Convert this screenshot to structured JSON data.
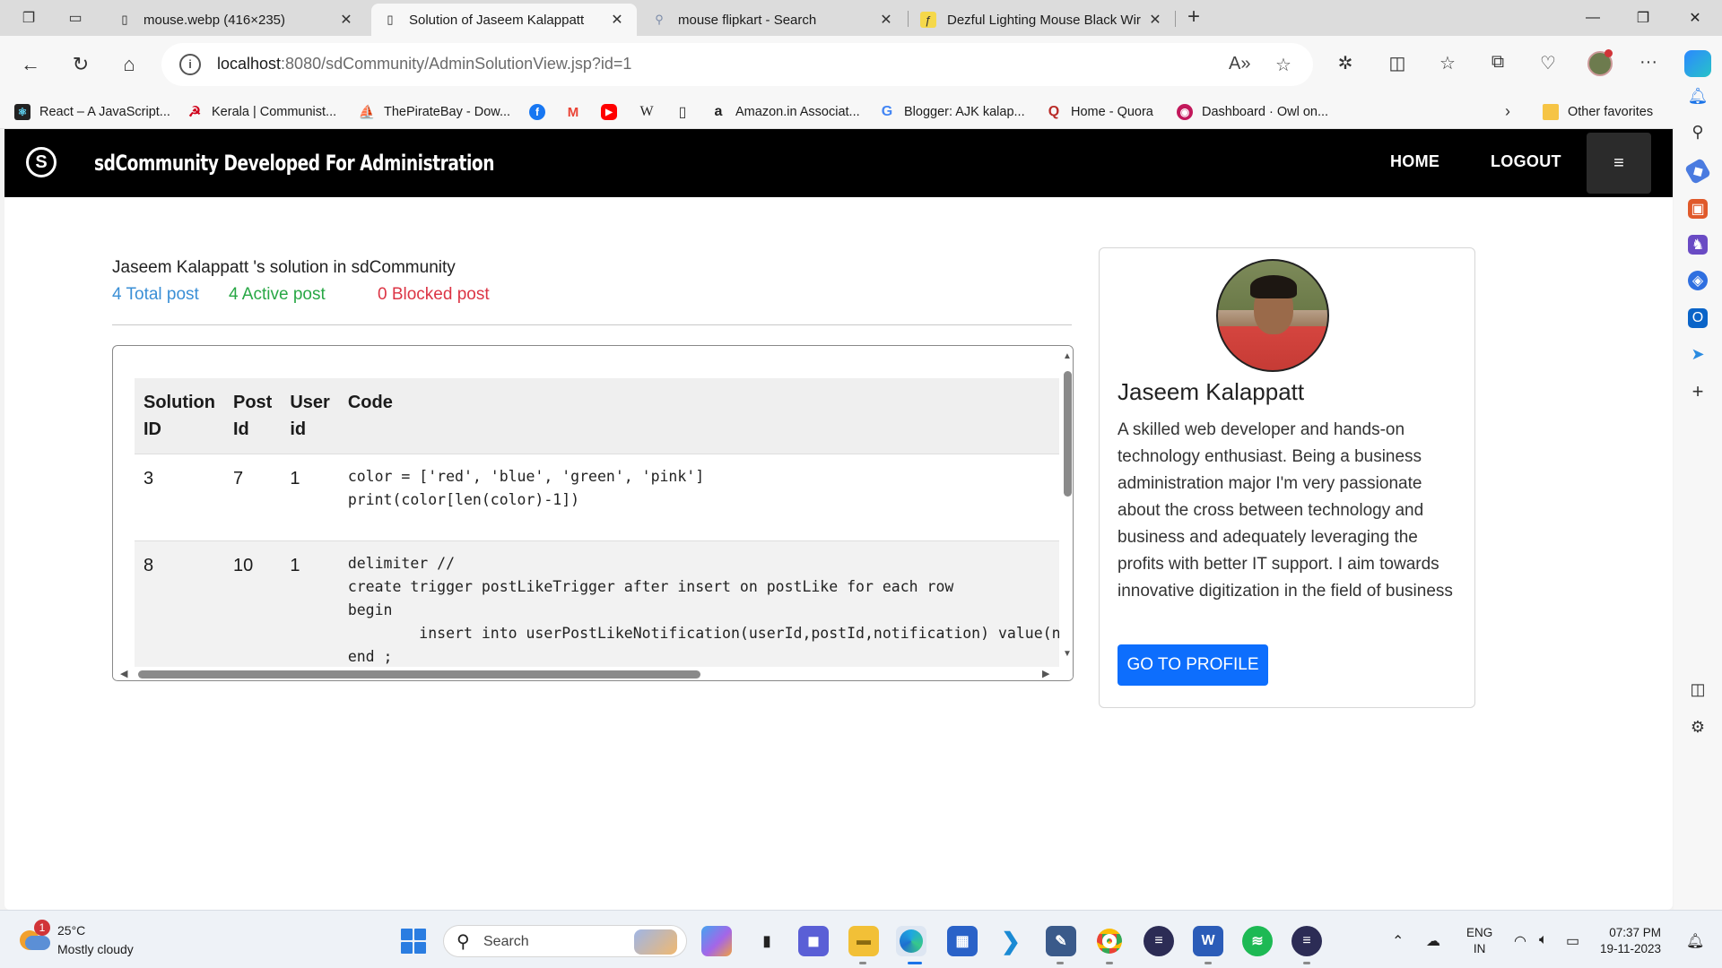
{
  "browser": {
    "tabs": [
      {
        "title": "mouse.webp (416×235)",
        "active": false
      },
      {
        "title": "Solution of Jaseem Kalappatt",
        "active": true
      },
      {
        "title": "mouse flipkart - Search",
        "active": false
      },
      {
        "title": "Dezful Lighting Mouse Black Wir",
        "active": false
      }
    ],
    "url_host": "localhost",
    "url_rest": ":8080/sdCommunity/AdminSolutionView.jsp?id=1",
    "favorites": [
      {
        "label": "React – A JavaScript...",
        "icon": "react-icon",
        "color": "#222222",
        "glyph": "⚛"
      },
      {
        "label": "Kerala | Communist...",
        "icon": "hammer-sickle-icon",
        "color": "#d0021b",
        "glyph": "☭"
      },
      {
        "label": "ThePirateBay - Dow...",
        "icon": "pirate-ship-icon",
        "color": "#333333",
        "glyph": "⛵"
      },
      {
        "label": "",
        "icon": "facebook-icon",
        "color": "#1877f2",
        "glyph": "f"
      },
      {
        "label": "",
        "icon": "gmail-icon",
        "color": "#ea4335",
        "glyph": "M"
      },
      {
        "label": "",
        "icon": "youtube-icon",
        "color": "#ff0000",
        "glyph": "▶"
      },
      {
        "label": "",
        "icon": "wikipedia-icon",
        "color": "#ffffff",
        "glyph": "W"
      },
      {
        "label": "",
        "icon": "page-icon",
        "color": "#ffffff",
        "glyph": "▯"
      },
      {
        "label": "Amazon.in Associat...",
        "icon": "amazon-icon",
        "color": "#ffffff",
        "glyph": "a"
      },
      {
        "label": "Blogger: AJK kalap...",
        "icon": "google-icon",
        "color": "#ffffff",
        "glyph": "G"
      },
      {
        "label": "Home - Quora",
        "icon": "quora-icon",
        "color": "#b92b27",
        "glyph": "Q"
      },
      {
        "label": "Dashboard · Owl on...",
        "icon": "owl-icon",
        "color": "#c2185b",
        "glyph": "◉"
      }
    ],
    "other_favorites": "Other favorites"
  },
  "site": {
    "title": "sdCommunity Developed For Administration",
    "nav": {
      "home": "HOME",
      "logout": "LOGOUT"
    },
    "menu_glyph": "≡"
  },
  "solutions": {
    "heading": "Jaseem Kalappatt 's solution in sdCommunity",
    "total": "4 Total post",
    "active": "4 Active post",
    "blocked": "0 Blocked post",
    "colors": {
      "total": "#3a8fd6",
      "active": "#28a745",
      "blocked": "#dc3545"
    },
    "columns": [
      "Solution ID",
      "Post Id",
      "User id",
      "Code"
    ],
    "rows": [
      {
        "solution_id": "3",
        "post_id": "7",
        "user_id": "1",
        "code": "color = ['red', 'blue', 'green', 'pink']\nprint(color[len(color)-1])"
      },
      {
        "solution_id": "8",
        "post_id": "10",
        "user_id": "1",
        "code": "delimiter //\ncreate trigger postLikeTrigger after insert on postLike for each row\nbegin\n        insert into userPostLikeNotification(userId,postId,notification) value(new\nend ;"
      }
    ]
  },
  "profile": {
    "name": "Jaseem Kalappatt",
    "bio": "A skilled web developer and hands-on technology enthusiast. Being a business administration major I'm very passionate about the cross between technology and business and adequately leveraging the profits with better IT support. I aim towards innovative digitization in the field of business",
    "button": "GO TO PROFILE",
    "accent": "#0d6efd"
  },
  "taskbar": {
    "weather_temp": "25°C",
    "weather_cond": "Mostly cloudy",
    "weather_badge": "1",
    "search_placeholder": "Search",
    "lang_line1": "ENG",
    "lang_line2": "IN",
    "time": "07:37 PM",
    "date": "19-11-2023"
  }
}
